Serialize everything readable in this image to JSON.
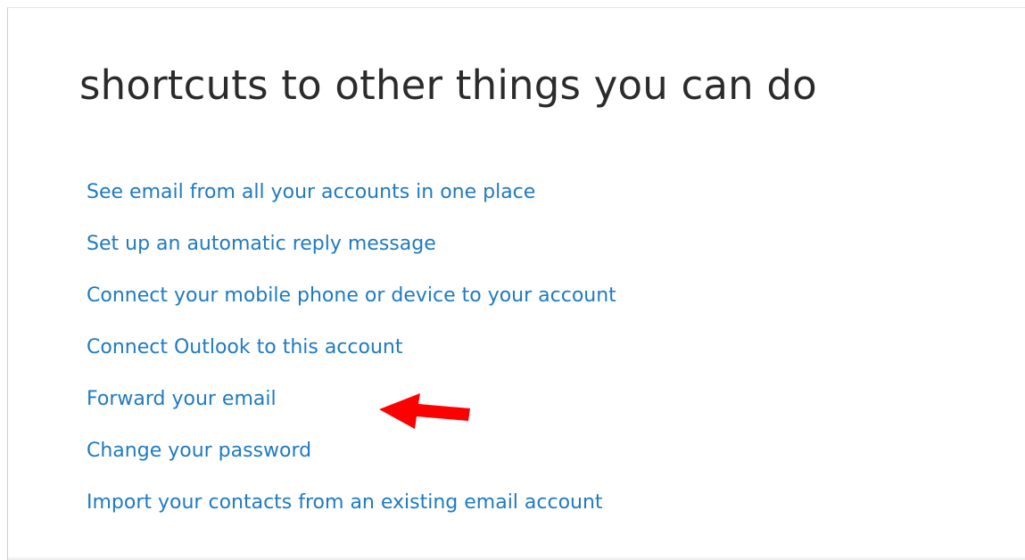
{
  "page": {
    "title": "shortcuts to other things you can do"
  },
  "shortcuts": [
    {
      "label": "See email from all your accounts in one place"
    },
    {
      "label": "Set up an automatic reply message"
    },
    {
      "label": "Connect your mobile phone or device to your account"
    },
    {
      "label": "Connect Outlook to this account"
    },
    {
      "label": "Forward your email",
      "highlighted": true
    },
    {
      "label": "Change your password"
    },
    {
      "label": "Import your contacts from an existing email account"
    }
  ],
  "annotation": {
    "icon": "red-arrow-pointer-icon",
    "color": "#ff0000",
    "points_to": "Forward your email"
  },
  "colors": {
    "link": "#1f7ac2",
    "title": "#2b2b2b",
    "background": "#ffffff"
  }
}
